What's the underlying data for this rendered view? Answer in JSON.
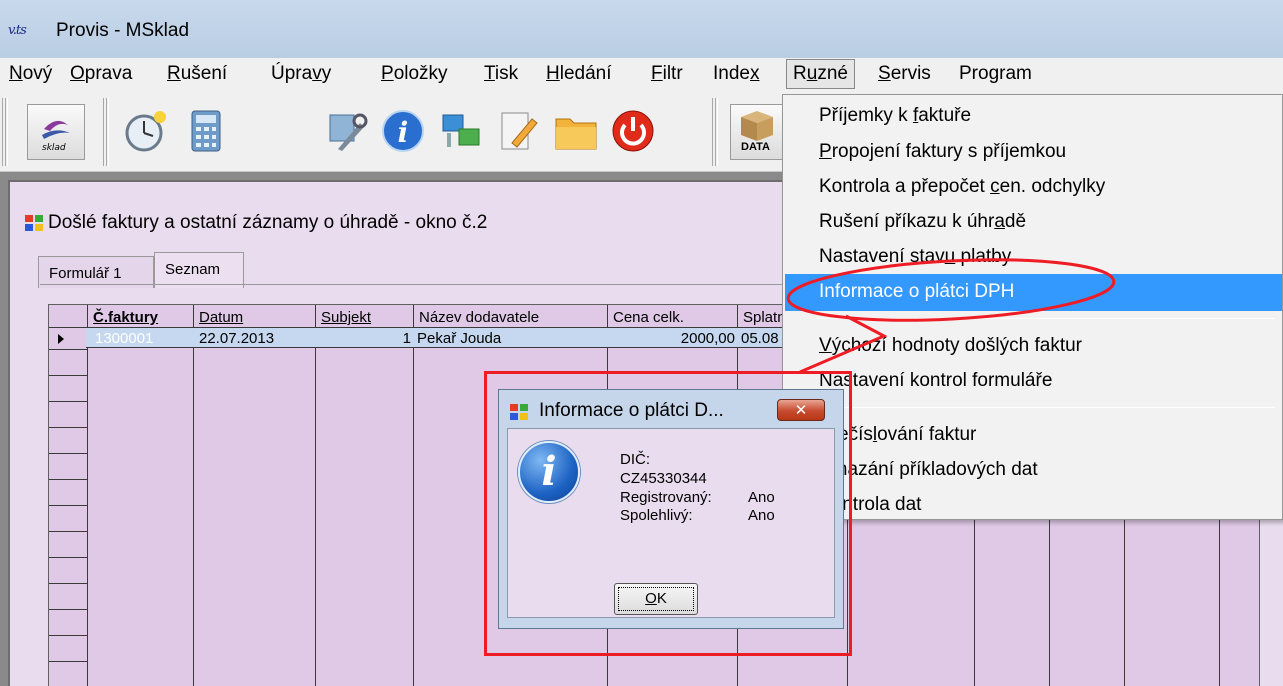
{
  "app": {
    "icon_text": "v.ts",
    "title": "Provis - MSklad"
  },
  "menu": [
    {
      "pre": "",
      "u": "N",
      "post": "ový"
    },
    {
      "pre": "",
      "u": "O",
      "post": "prava"
    },
    {
      "pre": "",
      "u": "R",
      "post": "ušení"
    },
    {
      "pre": "Úpra",
      "u": "v",
      "post": "y"
    },
    {
      "pre": "",
      "u": "P",
      "post": "oložky"
    },
    {
      "pre": "",
      "u": "T",
      "post": "isk"
    },
    {
      "pre": "",
      "u": "H",
      "post": "ledání"
    },
    {
      "pre": "",
      "u": "F",
      "post": "iltr"
    },
    {
      "pre": "Inde",
      "u": "x",
      "post": ""
    },
    {
      "pre": "R",
      "u": "u",
      "post": "zné"
    },
    {
      "pre": "",
      "u": "S",
      "post": "ervis"
    },
    {
      "pre": "Pro",
      "u": "g",
      "post": "ram"
    }
  ],
  "toolbar": {
    "sklad_label": "sklad",
    "data_label": "DATA",
    "icons": [
      "sklad-logo-icon",
      "clock-icon",
      "calculator-icon",
      "tools-icon",
      "info-icon",
      "network-icon",
      "edit-icon",
      "folder-icon",
      "power-icon",
      "data-box-icon"
    ]
  },
  "window": {
    "title": "Došlé faktury a ostatní záznamy o úhradě - okno č.2",
    "tabs": [
      "Formulář 1",
      "Seznam"
    ]
  },
  "grid": {
    "columns": [
      "Č.faktury",
      "Datum",
      "Subjekt",
      "Název dodavatele",
      "Cena celk.",
      "Splatn"
    ],
    "row": {
      "faktura": "1300001",
      "datum": "22.07.2013",
      "subjekt": "1",
      "nazev": "Pekař Jouda",
      "cena": "2000,00",
      "splatnost": "05.08"
    }
  },
  "dropdown": {
    "items": [
      {
        "pre": "Příjemky k ",
        "u": "f",
        "post": "aktuře"
      },
      {
        "pre": "",
        "u": "P",
        "post": "ropojení faktury s příjemkou"
      },
      {
        "pre": "Kontrola a přepočet ",
        "u": "c",
        "post": "en. odchylky"
      },
      {
        "pre": "Rušení příkazu k úhr",
        "u": "a",
        "post": "dě"
      },
      {
        "pre": "Nastavení stav",
        "u": "u",
        "post": " platby"
      },
      {
        "pre": "Informace o plátci DPH",
        "u": "",
        "post": ""
      },
      {
        "pre": "",
        "u": "V",
        "post": "ýchozí hodnoty došlých faktur"
      },
      {
        "pre": "Nastavení kontrol formuláře",
        "u": "",
        "post": ""
      },
      {
        "pre": "Přečís",
        "u": "l",
        "post": "ování faktur"
      },
      {
        "pre": "Smazání příkladových dat",
        "u": "",
        "post": ""
      },
      {
        "pre": "Kontrola dat",
        "u": "",
        "post": ""
      }
    ]
  },
  "dialog": {
    "title": "Informace o plátci D...",
    "close": "✕",
    "dic_label": "DIČ:",
    "dic_value": "CZ45330344",
    "registered_label": "Registrovaný:",
    "registered_value": "Ano",
    "reliable_label": "Spolehlivý:",
    "reliable_value": "Ano",
    "ok_pre": "",
    "ok_u": "O",
    "ok_post": "K"
  },
  "colors": {
    "annotation": "#ee1c24",
    "highlight": "#3399ff",
    "grid_bg": "#dfc9e6"
  }
}
